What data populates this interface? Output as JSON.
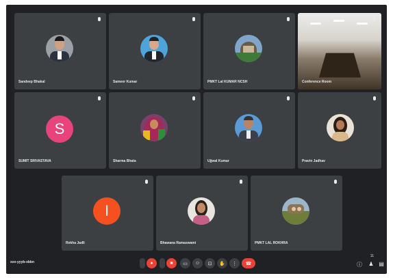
{
  "meeting": {
    "id": "xxx-yyyb-xbbn"
  },
  "participants": [
    {
      "name": "Sandeep Bhakal",
      "avatar": "photo-man-grey-bg"
    },
    {
      "name": "Sameer Kumar",
      "avatar": "photo-man-blue-bg"
    },
    {
      "name": "PMKT Lal KUMAR NCSH",
      "avatar": "photo-building"
    },
    {
      "name": "Conference Room",
      "avatar": "photo-conference-room"
    },
    {
      "name": "SUMIT SRIVASTAVA",
      "avatar": "letter",
      "letter": "S",
      "color": "#e8437a"
    },
    {
      "name": "Sharma Bhata",
      "avatar": "photo-woman-colorful"
    },
    {
      "name": "Ujjwal Kumar",
      "avatar": "photo-man-blue-bg"
    },
    {
      "name": "Pravin Jadhav",
      "avatar": "photo-woman-outdoor"
    },
    {
      "name": "Rekha Jadli",
      "avatar": "letter",
      "letter": "I",
      "color": "#f4511e"
    },
    {
      "name": "Bhawana Ramaswami",
      "avatar": "photo-woman-white-bg"
    },
    {
      "name": "PMKT LAL ROKHRA",
      "avatar": "photo-outdoor-group"
    }
  ],
  "controls": {
    "left_count": "",
    "participants_count": "11"
  },
  "colors": {
    "stage": "#202124",
    "tile": "#3c4043",
    "end_call": "#ea4335"
  }
}
